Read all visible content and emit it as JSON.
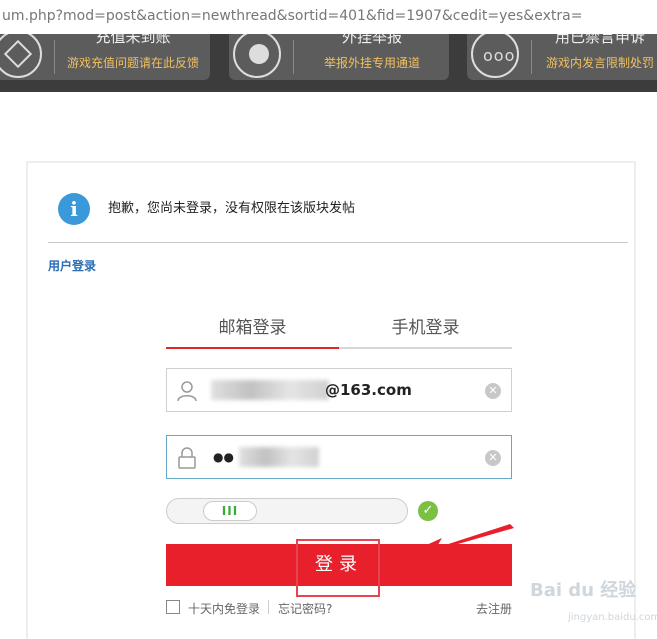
{
  "browser": {
    "url": "um.php?mod=post&action=newthread&sortid=401&fid=1907&cedit=yes&extra="
  },
  "banner": {
    "tiles": [
      {
        "title": "充值未到账",
        "subtitle": "游戏充值问题请在此反馈",
        "icon": "diamond-icon"
      },
      {
        "title": "外挂举报",
        "subtitle": "举报外挂专用通道",
        "icon": "headset-icon"
      },
      {
        "title": "用已禁言申诉",
        "subtitle": "游戏内发言限制处罚",
        "icon": "chat-bubble-icon"
      }
    ]
  },
  "notice": {
    "text": "抱歉，您尚未登录，没有权限在该版块发帖",
    "icon": "info-icon"
  },
  "section": {
    "title": "用户登录"
  },
  "tabs": [
    {
      "label": "邮箱登录",
      "active": true
    },
    {
      "label": "手机登录",
      "active": false
    }
  ],
  "form": {
    "email_value": "@163.com",
    "password_value": "●●",
    "slider_handle": "III",
    "login_label": "登录",
    "remember_label": "十天内免登录",
    "forgot_label": "忘记密码?",
    "register_label": "去注册"
  },
  "watermark": {
    "brand": "Bai du 经验",
    "site": "jingyan.baidu.com"
  },
  "colors": {
    "accent": "#e8202b",
    "link": "#2a6db5",
    "info": "#3a9ad9",
    "ok": "#7ac143"
  }
}
